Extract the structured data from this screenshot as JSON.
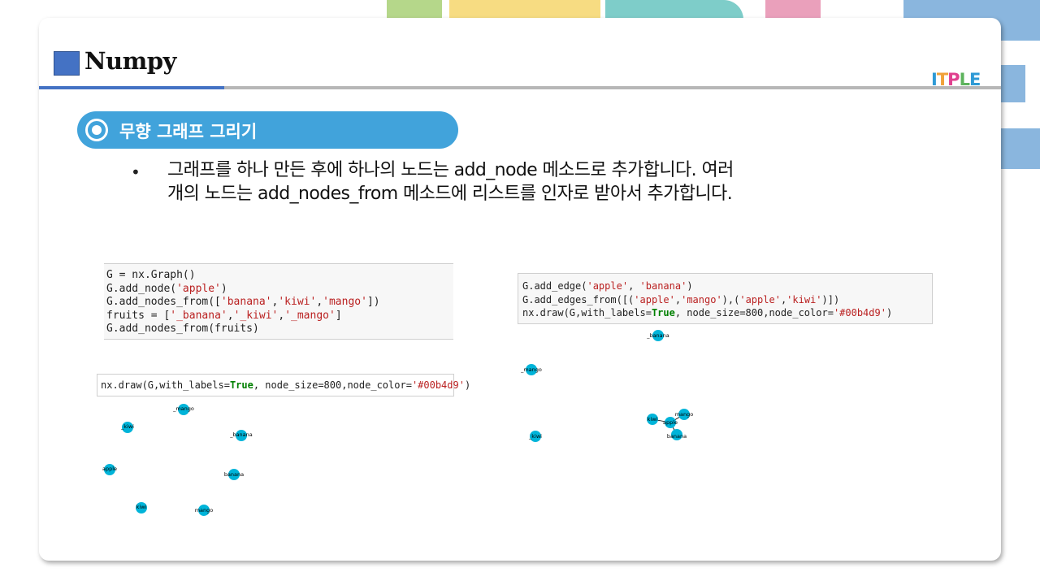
{
  "slide": {
    "title": "Numpy",
    "logo": [
      "I",
      "T",
      "P",
      "L",
      "E"
    ],
    "section_title": "무향 그래프 그리기",
    "bullet_symbol": "•",
    "bullet_line1": "그래프를 하나 만든 후에 하나의 노드는 add_node 메소드로 추가합니다. 여러",
    "bullet_line2": "개의 노드는 add_nodes_from 메소드에 리스트를 인자로 받아서 추가합니다."
  },
  "code1": {
    "line1": "G = nx.Graph()",
    "line2_a": "G.add_node(",
    "line2_s": "'apple'",
    "line2_b": ")",
    "line3_a": "G.add_nodes_from([",
    "line3_s1": "'banana'",
    "line3_c1": ",",
    "line3_s2": "'kiwi'",
    "line3_c2": ",",
    "line3_s3": "'mango'",
    "line3_b": "])",
    "line4_a": "fruits = [",
    "line4_s1": "'_banana'",
    "line4_c1": ",",
    "line4_s2": "'_kiwi'",
    "line4_c2": ",",
    "line4_s3": "'_mango'",
    "line4_b": "]",
    "line5": "G.add_nodes_from(fruits)"
  },
  "code2": {
    "a": "nx.draw(G,with_labels=",
    "kw": "True",
    "b": ", node_size=800,node_color=",
    "s": "'#00b4d9'",
    "c": ")"
  },
  "code3": {
    "l1_a": "G.add_edge(",
    "l1_s1": "'apple'",
    "l1_c": ", ",
    "l1_s2": "'banana'",
    "l1_b": ")",
    "l2_a": "G.add_edges_from([(",
    "l2_s1": "'apple'",
    "l2_c1": ",",
    "l2_s2": "'mango'",
    "l2_m": "),(",
    "l2_s3": "'apple'",
    "l2_c2": ",",
    "l2_s4": "'kiwi'",
    "l2_b": ")])",
    "l3_a": "nx.draw(G,with_labels=",
    "l3_kw": "True",
    "l3_b": ", node_size=800,node_color=",
    "l3_s": "'#00b4d9'",
    "l3_c": ")"
  },
  "graph1": {
    "nodes": [
      {
        "label": "_mango"
      },
      {
        "label": "_kiwi"
      },
      {
        "label": "_banana"
      },
      {
        "label": "apple"
      },
      {
        "label": "banana"
      },
      {
        "label": "kiwi"
      },
      {
        "label": "mango"
      }
    ]
  },
  "graph2": {
    "nodes": [
      {
        "label": "_banana"
      },
      {
        "label": "_mango"
      },
      {
        "label": "_kiwi"
      },
      {
        "label": "kiwi"
      },
      {
        "label": "apple"
      },
      {
        "label": "mango"
      },
      {
        "label": "banana"
      }
    ]
  },
  "colors": {
    "node": "#00b4d9",
    "accent_blue": "#4472c4",
    "pill": "#41a3db"
  }
}
